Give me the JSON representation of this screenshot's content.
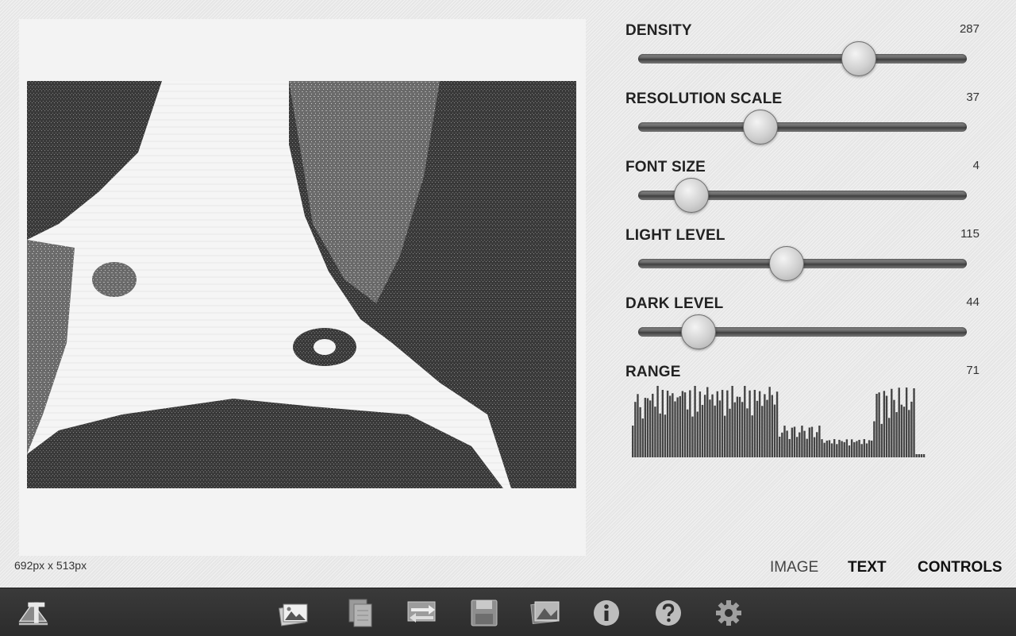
{
  "canvas": {
    "dimensions_label": "692px x 513px"
  },
  "controls": [
    {
      "id": "density",
      "label": "DENSITY",
      "value": "287",
      "slider_fraction": 0.67
    },
    {
      "id": "resolution-scale",
      "label": "RESOLUTION SCALE",
      "value": "37",
      "slider_fraction": 0.37
    },
    {
      "id": "font-size",
      "label": "FONT SIZE",
      "value": "4",
      "slider_fraction": 0.16
    },
    {
      "id": "light-level",
      "label": "LIGHT LEVEL",
      "value": "115",
      "slider_fraction": 0.45
    },
    {
      "id": "dark-level",
      "label": "DARK LEVEL",
      "value": "44",
      "slider_fraction": 0.18
    }
  ],
  "range": {
    "label": "RANGE",
    "value": "71"
  },
  "view_tabs": [
    {
      "label": "IMAGE",
      "active": false
    },
    {
      "label": "TEXT",
      "active": true
    },
    {
      "label": "CONTROLS",
      "active": true
    }
  ],
  "toolbar": {
    "app_icon": "ascii-text-logo-icon",
    "buttons": [
      {
        "name": "open-images-icon"
      },
      {
        "name": "copy-documents-icon"
      },
      {
        "name": "export-swap-icon"
      },
      {
        "name": "save-icon"
      },
      {
        "name": "image-gallery-icon"
      },
      {
        "name": "info-icon"
      },
      {
        "name": "help-icon"
      },
      {
        "name": "settings-gear-icon"
      }
    ]
  },
  "colors": {
    "toolbar_bg": "#2f2f2f",
    "panel_bg": "#ebebeb",
    "histogram_bar": "#444444"
  }
}
